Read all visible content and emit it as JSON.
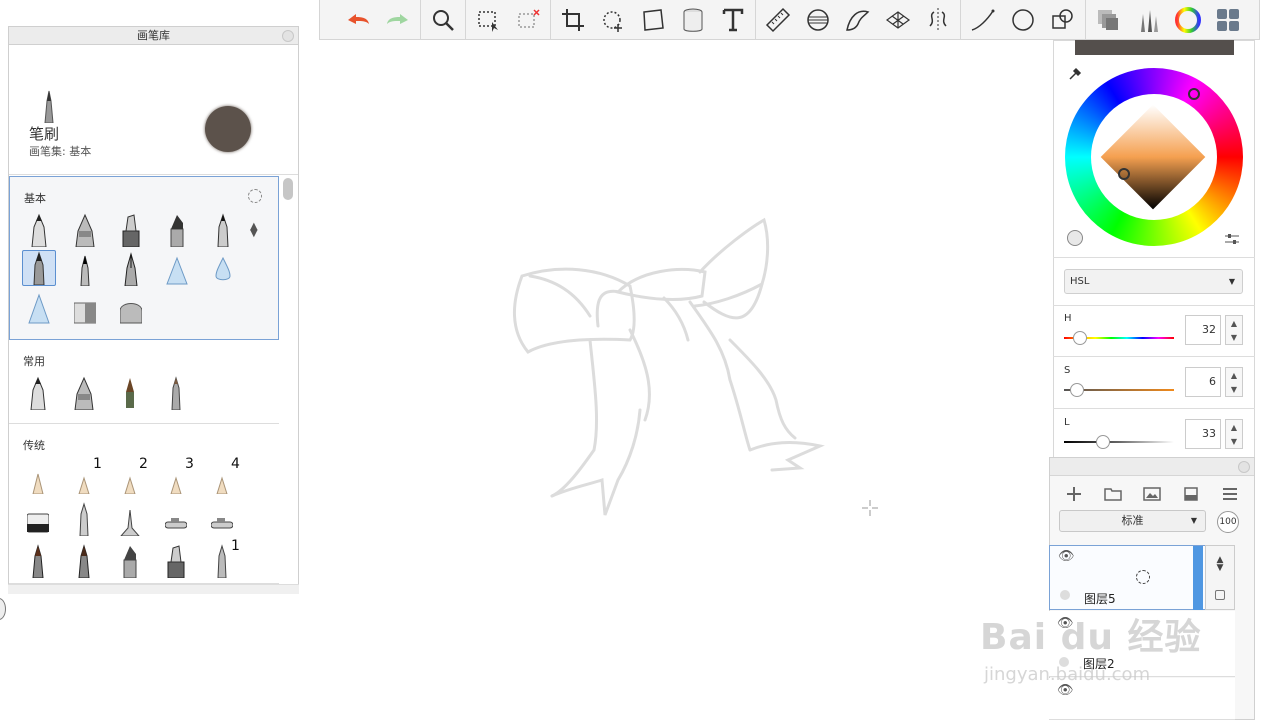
{
  "toolbar": {
    "tools": [
      "undo-icon",
      "redo-icon",
      "zoom-icon",
      "rect-select-icon",
      "lasso-select-icon",
      "crop-icon",
      "transform-icon",
      "distort-icon",
      "fill-bucket-icon",
      "text-icon",
      "ruler-icon",
      "ellipse-guide-icon",
      "french-curve-icon",
      "perspective-icon",
      "symmetry-icon",
      "stroke-icon",
      "shape-icon",
      "copy-icon",
      "layers-icon",
      "brush-library-icon",
      "color-wheel-icon",
      "palette-icon"
    ]
  },
  "brush_library": {
    "title": "画笔库",
    "brush_name": "笔刷",
    "brush_set": "画笔集: 基本",
    "sections": {
      "basic": "基本",
      "common": "常用",
      "traditional": "传统"
    },
    "numbers": [
      "1",
      "2",
      "3",
      "4",
      "1"
    ]
  },
  "color": {
    "current": "#544f4c",
    "mode": "HSL",
    "h_label": "H",
    "h_value": "32",
    "s_label": "S",
    "s_value": "6",
    "l_label": "L",
    "l_value": "33",
    "spin_up": "▲",
    "spin_down": "▼",
    "dropdown_arrow": "▼"
  },
  "layers": {
    "blend_mode": "标准",
    "opacity": "100",
    "layer_top": "图层5",
    "layer_mid": "图层2",
    "eye": "👁"
  },
  "watermark": {
    "logo": "Bai du 经验",
    "url": "jingyan.baidu.com"
  }
}
